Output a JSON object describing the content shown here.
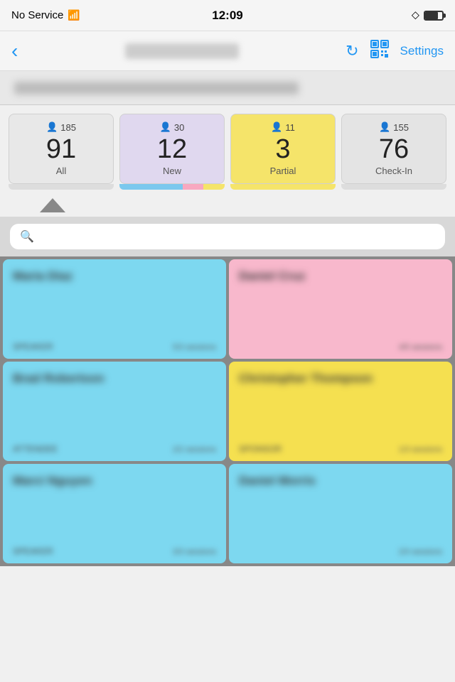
{
  "statusBar": {
    "carrier": "No Service",
    "time": "12:09",
    "wifi": true,
    "bluetooth": true,
    "battery": 75
  },
  "navBar": {
    "backLabel": "‹",
    "refreshIcon": "refresh",
    "qrIcon": "qr",
    "settingsLabel": "Settings"
  },
  "stats": [
    {
      "id": "all",
      "peopleCount": 185,
      "number": 91,
      "label": "All",
      "colorClass": "all"
    },
    {
      "id": "new",
      "peopleCount": 30,
      "number": 12,
      "label": "New",
      "colorClass": "new"
    },
    {
      "id": "partial",
      "peopleCount": 11,
      "number": 3,
      "label": "Partial",
      "colorClass": "partial"
    },
    {
      "id": "checkin",
      "peopleCount": 155,
      "number": 76,
      "label": "Check-In",
      "colorClass": "checkin"
    }
  ],
  "search": {
    "placeholder": "",
    "value": ""
  },
  "cards": [
    {
      "id": 1,
      "name": "Maria Diaz",
      "meta1": "SPEAKER",
      "meta2": "5/3 sessions",
      "color": "blue"
    },
    {
      "id": 2,
      "name": "Daniel Cruz",
      "meta1": "",
      "meta2": "4/5 sessions",
      "color": "pink"
    },
    {
      "id": 3,
      "name": "Brad Robertson",
      "meta1": "ATTENDEE",
      "meta2": "2/2 sessions",
      "color": "blue"
    },
    {
      "id": 4,
      "name": "Christopher Thompson",
      "meta1": "SPONSOR",
      "meta2": "1/3 sessions",
      "color": "yellow"
    },
    {
      "id": 5,
      "name": "Marci Nguyen",
      "meta1": "SPEAKER",
      "meta2": "3/3 sessions",
      "color": "blue"
    },
    {
      "id": 6,
      "name": "Daniel Morris",
      "meta1": "",
      "meta2": "2/4 sessions",
      "color": "blue"
    }
  ],
  "icons": {
    "back": "‹",
    "refresh": "↻",
    "search": "⌕",
    "bluetooth": "⚡",
    "people": "👥"
  }
}
